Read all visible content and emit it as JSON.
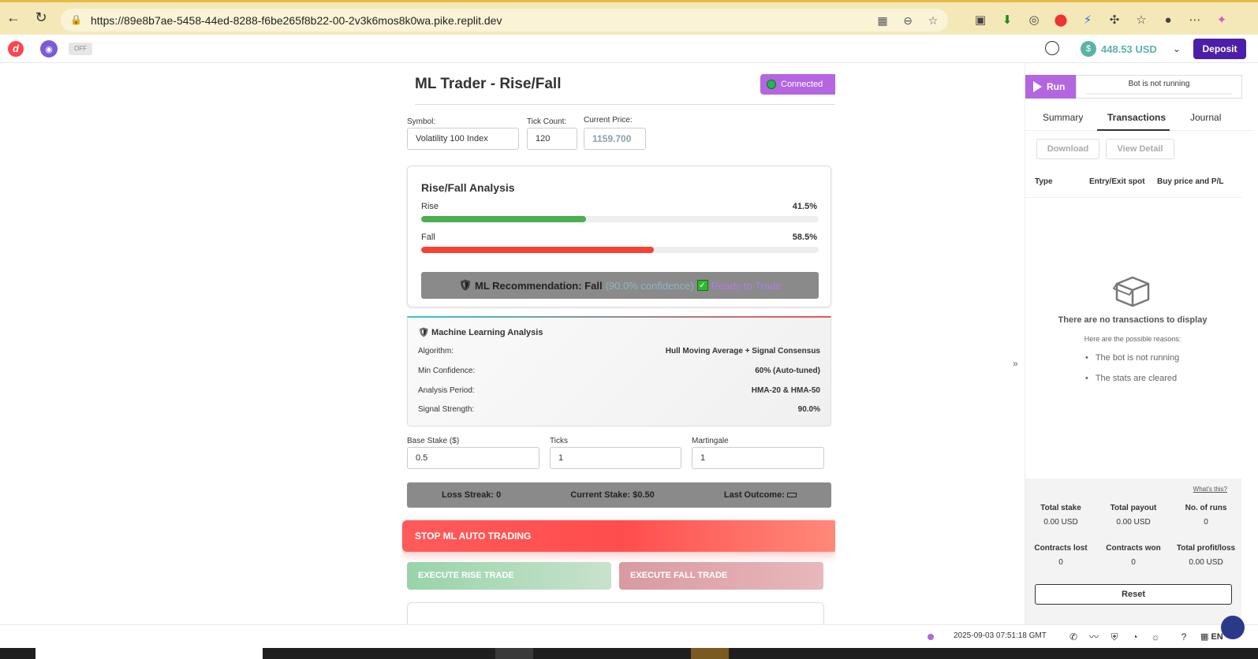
{
  "browser": {
    "url": "https://89e8b7ae-5458-44ed-8288-f6be265f8b22-00-2v3k6mos8k0wa.pike.replit.dev"
  },
  "header": {
    "toggle_label": "OFF",
    "balance": "448.53 USD",
    "deposit_label": "Deposit"
  },
  "main": {
    "title": "ML Trader - Rise/Fall",
    "status": "Connected",
    "symbol_label": "Symbol:",
    "symbol_value": "Volatility 100 Index",
    "tick_count_label": "Tick Count:",
    "tick_count_value": "120",
    "current_price_label": "Current Price:",
    "current_price_value": "1159.700",
    "analysis": {
      "heading": "Rise/Fall Analysis",
      "rise_label": "Rise",
      "rise_pct_text": "41.5%",
      "rise_pct": 41.5,
      "fall_label": "Fall",
      "fall_pct_text": "58.5%",
      "fall_pct": 58.5,
      "rec_label": "ML Recommendation: Fall",
      "rec_confidence": "(90.0% confidence)",
      "rec_ready": "Ready to Trade"
    },
    "ml": {
      "heading": "Machine Learning Analysis",
      "rows": [
        {
          "label": "Algorithm:",
          "value": "Hull Moving Average + Signal Consensus"
        },
        {
          "label": "Min Confidence:",
          "value": "60% (Auto-tuned)"
        },
        {
          "label": "Analysis Period:",
          "value": "HMA-20 & HMA-50"
        },
        {
          "label": "Signal Strength:",
          "value": "90.0%"
        }
      ]
    },
    "base_stake_label": "Base Stake ($)",
    "base_stake_value": "0.5",
    "ticks_label": "Ticks",
    "ticks_value": "1",
    "martingale_label": "Martingale",
    "martingale_value": "1",
    "loss_streak": "Loss Streak: 0",
    "current_stake": "Current Stake: $0.50",
    "last_outcome": "Last Outcome:",
    "stop_label": "STOP ML AUTO TRADING",
    "rise_trade_label": "EXECUTE RISE TRADE",
    "fall_trade_label": "EXECUTE FALL TRADE"
  },
  "right_panel": {
    "run_label": "Run",
    "bot_status": "Bot is not running",
    "tabs": [
      "Summary",
      "Transactions",
      "Journal"
    ],
    "download_label": "Download",
    "view_detail_label": "View Detail",
    "columns": [
      "Type",
      "Entry/Exit spot",
      "Buy price and P/L"
    ],
    "empty_title": "There are no transactions to display",
    "empty_sub": "Here are the possible reasons:",
    "reasons": [
      "The bot is not running",
      "The stats are cleared"
    ],
    "whats_this": "What's this?",
    "summary": [
      {
        "label": "Total stake",
        "value": "0.00 USD"
      },
      {
        "label": "Total payout",
        "value": "0.00 USD"
      },
      {
        "label": "No. of runs",
        "value": "0"
      },
      {
        "label": "Contracts lost",
        "value": "0"
      },
      {
        "label": "Contracts won",
        "value": "0"
      },
      {
        "label": "Total profit/loss",
        "value": "0.00 USD"
      }
    ],
    "reset_label": "Reset"
  },
  "footer": {
    "time": "2025-09-03 07:51:18 GMT",
    "lang": "EN"
  },
  "colors": {
    "accent": "#b366e0",
    "deposit": "#4b1fa8",
    "rise": "#4caf50",
    "fall": "#f44336"
  }
}
